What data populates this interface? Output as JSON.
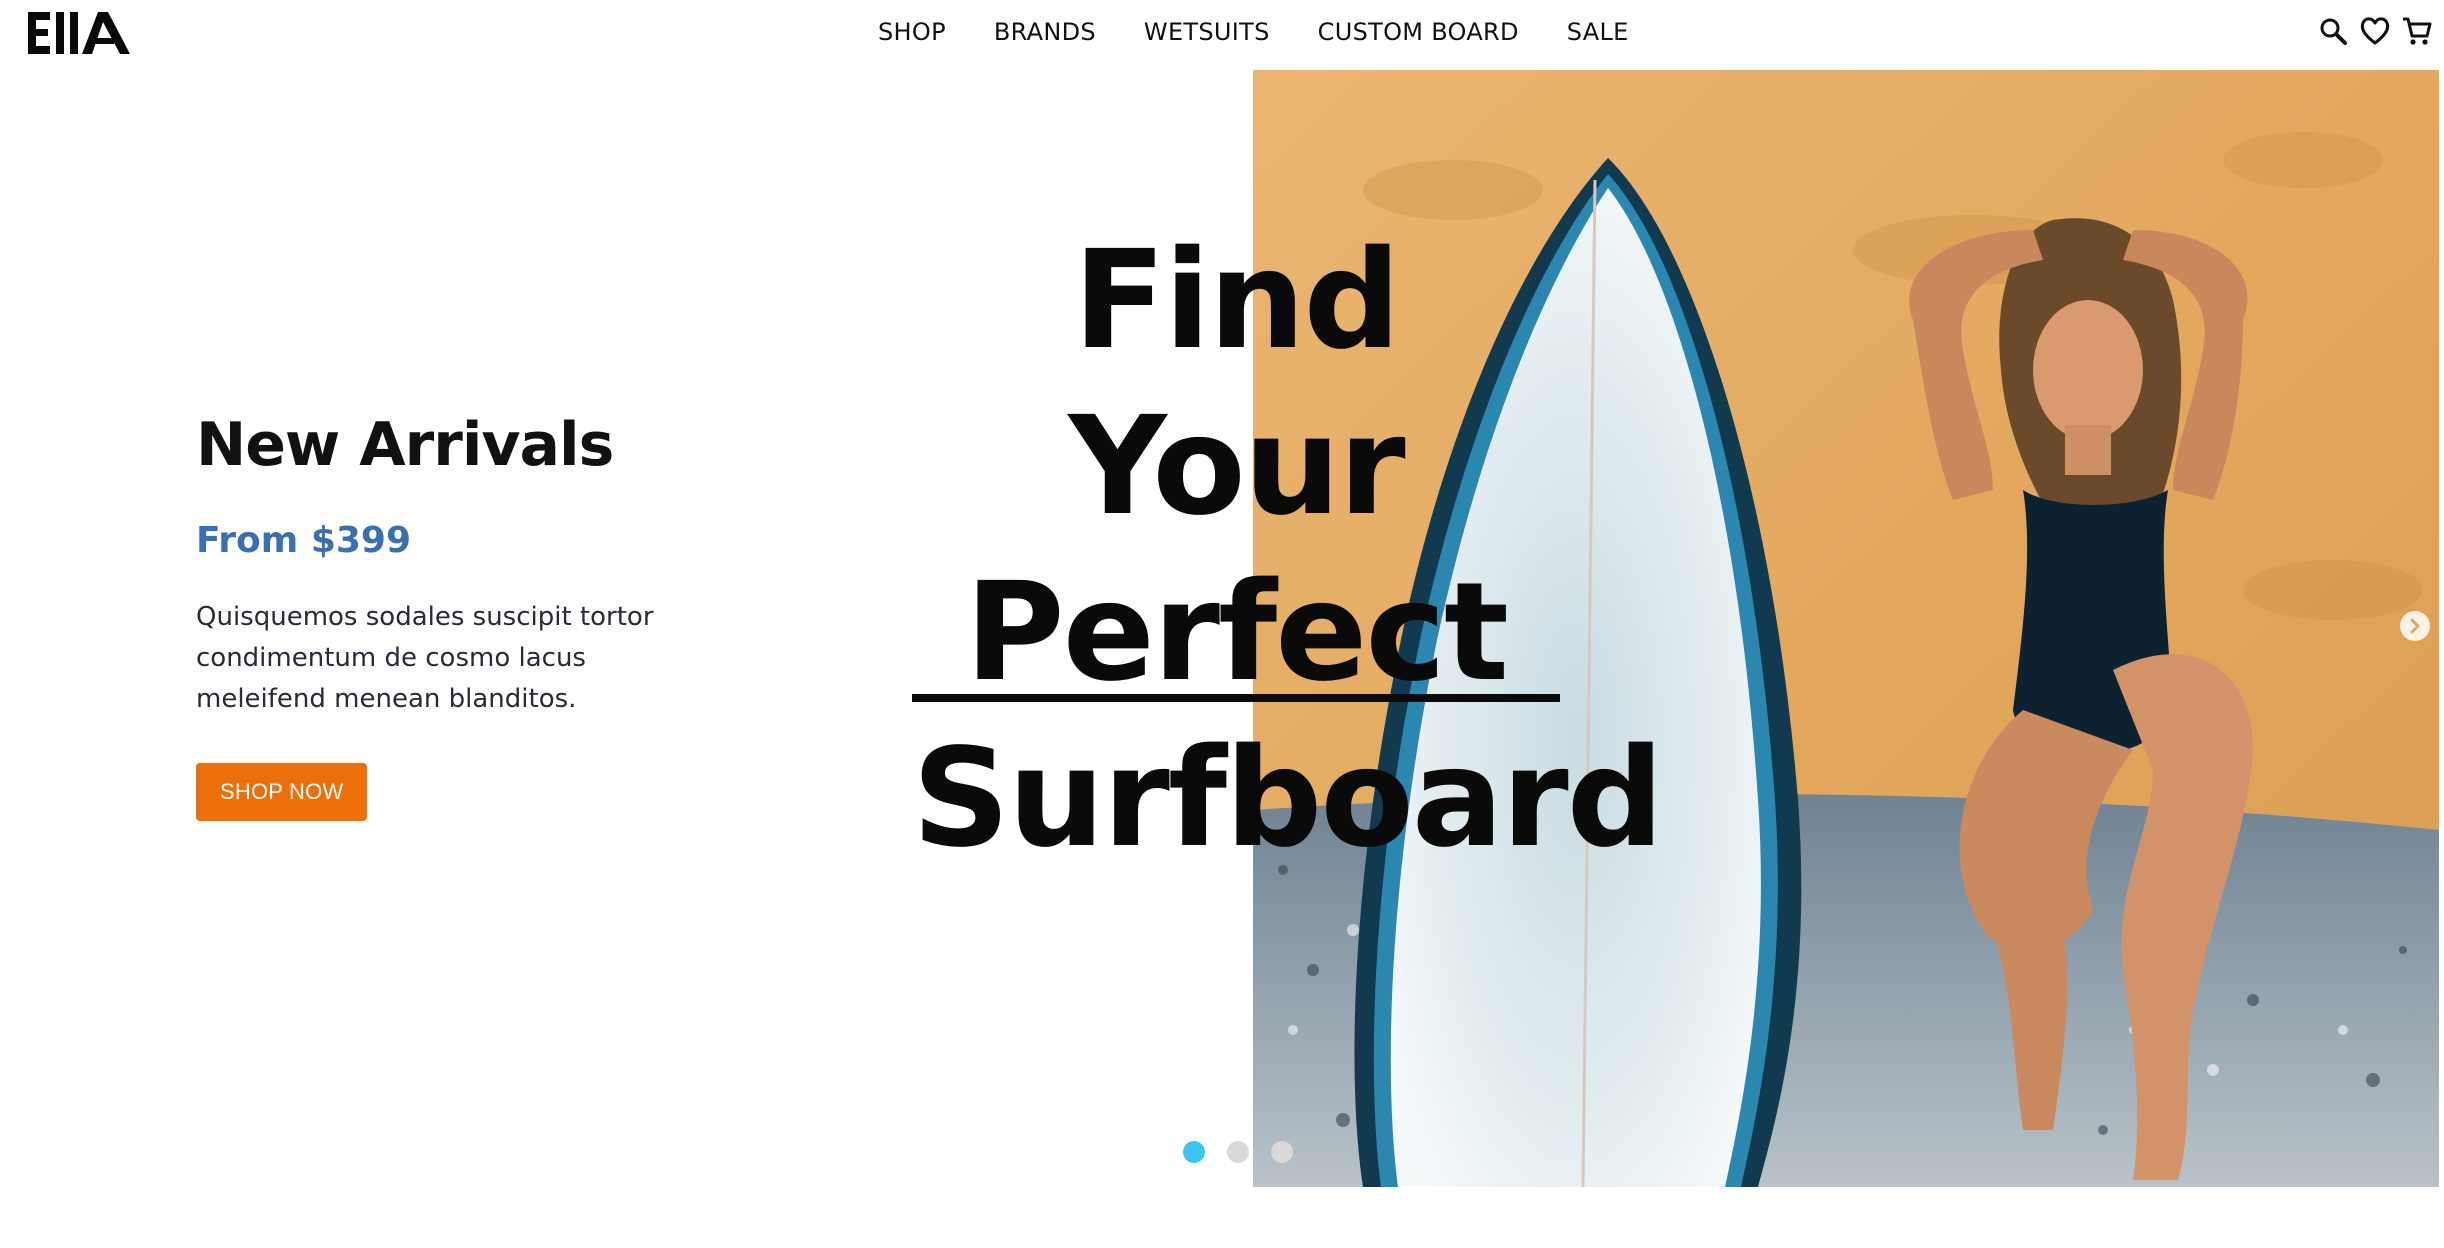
{
  "brand": {
    "logo_text": "ElIA"
  },
  "nav": {
    "items": [
      {
        "label": "SHOP"
      },
      {
        "label": "BRANDS"
      },
      {
        "label": "WETSUITS"
      },
      {
        "label": "CUSTOM BOARD"
      },
      {
        "label": "SALE"
      }
    ]
  },
  "header_icons": [
    "search-icon",
    "heart-icon",
    "cart-icon"
  ],
  "hero": {
    "eyebrow": "New Arrivals",
    "price": "From $399",
    "description": "Quisquemos sodales suscipit tortor condimentum de cosmo lacus meleifend menean blanditos.",
    "cta_label": "SHOP NOW",
    "headline_lines": [
      "Find Your",
      "Perfect",
      "Surfboard"
    ]
  },
  "carousel": {
    "slide_count": 3,
    "active_index": 0
  },
  "colors": {
    "accent_orange": "#ec6f0c",
    "price_blue": "#3a6fb1",
    "active_dot": "#3cc3f0",
    "wall_yellow": "#e3a85e"
  }
}
